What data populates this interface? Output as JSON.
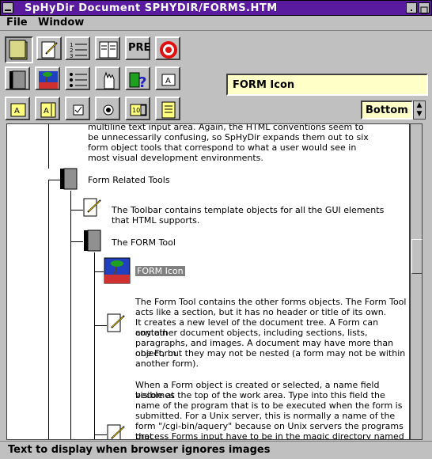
{
  "window": {
    "title": "SpHyDir Document   SPHYDIR/FORMS.HTM"
  },
  "menu": {
    "file": "File",
    "window": "Window"
  },
  "toolbar": {
    "pre_label": "PRE"
  },
  "name_field": {
    "value": "FORM Icon"
  },
  "align_field": {
    "value": "Bottom"
  },
  "tree": {
    "top_text": [
      "multiline text input area. Again, the HTML conventions seem to",
      "be unnecessarily confusing, so SpHyDir expands them out to six",
      "form object tools that correspond to what a user would see in",
      "most visual development environments."
    ],
    "section1": "Form Related Tools",
    "para1": [
      "The Toolbar contains template objects for all the GUI elements",
      "that HTML supports."
    ],
    "section2": "The FORM Tool",
    "image_label": "FORM Icon",
    "para2": [
      "The Form Tool contains the other forms objects. The Form Tool",
      "acts like a section, but it has no header or title of its own.",
      "It creates a new level of the document tree. A Form can contain",
      "any other document objects, including sections, lists,",
      "paragraphs, and images. A document may have more than one Form",
      "object, but they may not be nested (a form may not be within",
      "another form)."
    ],
    "para3": [
      "When a Form object is created or selected, a name field becomes",
      "visible at the top of the work area. Type into this field the",
      "name of the program that is to be executed when the form is",
      "submitted. For a Unix server, this is normally a name of the",
      "form \"/cgi-bin/aquery\" because on Unix servers the programs that",
      "process Forms input have to be in the magic directory named"
    ]
  },
  "status": {
    "text": "Text to display when browser ignores images"
  }
}
